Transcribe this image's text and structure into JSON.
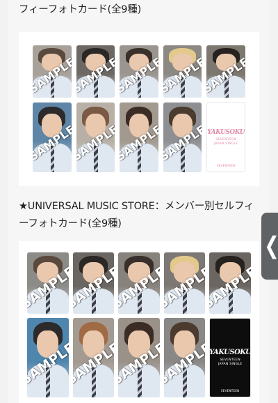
{
  "top_caption": "フィーフォトカード(全9種)",
  "section2_caption": "★UNIVERSAL MUSIC STORE：メンバー別セルフィーフォトカード(全9種)",
  "watermark": "SAMPLE",
  "grid1": {
    "cards": [
      {
        "hair": "#5a4a3e",
        "bg": "#a7a19a"
      },
      {
        "hair": "#2b2725",
        "bg": "#6d6864"
      },
      {
        "hair": "#3a302b",
        "bg": "#9b958f"
      },
      {
        "hair": "#e3c98c",
        "bg": "#8c8884"
      },
      {
        "hair": "#26221f",
        "bg": "#7c776f"
      },
      {
        "hair": "#2c2a2a",
        "bg": "#5f86a6"
      },
      {
        "hair": "#7a5a44",
        "bg": "#b8b0a6"
      },
      {
        "hair": "#3b2d25",
        "bg": "#a39a8f"
      },
      {
        "hair": "#4b3a2e",
        "bg": "#8e8f92"
      }
    ],
    "logo": {
      "title": "YAKUSOKU",
      "line1": "SEVENTEEN",
      "line2": "JAPAN SINGLE",
      "footer": "SEVENTEEN",
      "bg": "#ffffff",
      "color": "#e28aa6"
    }
  },
  "grid2": {
    "cards": [
      {
        "hair": "#5a4a3e",
        "bg": "#8d8b88"
      },
      {
        "hair": "#2b2725",
        "bg": "#6a6661"
      },
      {
        "hair": "#3a302b",
        "bg": "#88827c"
      },
      {
        "hair": "#e3c98c",
        "bg": "#7d7873"
      },
      {
        "hair": "#26221f",
        "bg": "#6b6661"
      },
      {
        "hair": "#2c2a2a",
        "bg": "#4f86ad"
      },
      {
        "hair": "#a06a44",
        "bg": "#a39a92"
      },
      {
        "hair": "#3b2d25",
        "bg": "#9a9189"
      },
      {
        "hair": "#4b3a2e",
        "bg": "#8a8886"
      }
    ],
    "logo": {
      "title": "YAKUSOKU",
      "line1": "SEVENTEEN",
      "line2": "JAPAN SINGLE",
      "footer": "SEVENTEEN",
      "bg": "#0d0d0d",
      "color": "#ffffff"
    }
  },
  "side_tab": {
    "icon": "chevron-left-icon",
    "glyph": "❮"
  }
}
